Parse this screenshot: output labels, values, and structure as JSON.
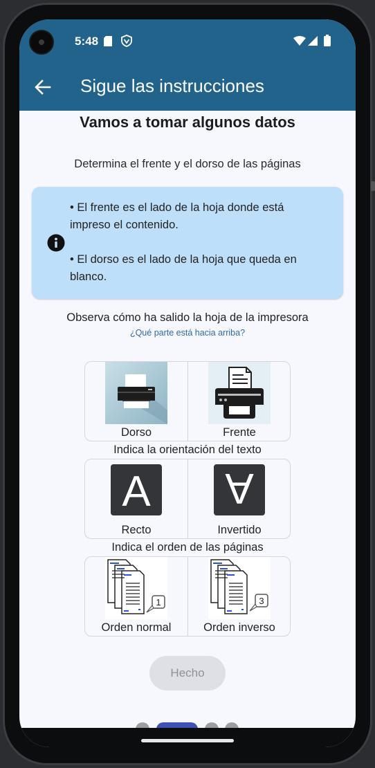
{
  "status_bar": {
    "time": "5:48",
    "icons": [
      "sd-card-icon",
      "vpn-shield-icon",
      "wifi-icon",
      "cell-signal-icon",
      "battery-icon"
    ]
  },
  "app_bar": {
    "back_icon": "arrow-back-icon",
    "title": "Sigue las instrucciones"
  },
  "main": {
    "heading": "Vamos a tomar algunos datos",
    "subheading": "Determina el frente y el dorso de las páginas",
    "info": {
      "icon": "info-icon",
      "line1": "• El frente es el lado de la hoja donde está impreso el contenido.",
      "line2": "• El dorso es el lado de la hoja que queda en blanco."
    },
    "question1": "Observa cómo ha salido la hoja de la impresora",
    "question1_hint": "¿Qué parte está hacia arriba?",
    "row1": {
      "left_label": "Dorso",
      "right_label": "Frente"
    },
    "question2": "Indica la orientación del texto",
    "row2": {
      "left_label": "Recto",
      "right_label": "Invertido",
      "glyph": "A"
    },
    "question3": "Indica el orden de las páginas",
    "row3": {
      "left_label": "Orden normal",
      "right_label": "Orden inverso",
      "left_badge": "1",
      "right_badge": "3"
    },
    "done_button": "Hecho"
  },
  "pager": {
    "pages": 4,
    "current": 2
  },
  "colors": {
    "app_bar": "#22638c",
    "background": "#f7f8fe",
    "info_box": "#bddff9",
    "hint_link": "#2b6aa6",
    "pager_active": "#3f51b5",
    "pager_inactive": "#9b9da2",
    "button_disabled": "#dfe0e5"
  }
}
